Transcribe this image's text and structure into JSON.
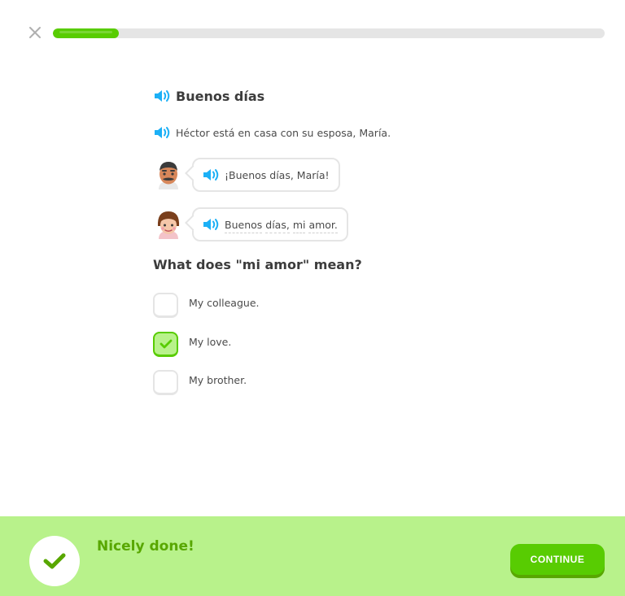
{
  "header": {
    "close_icon": "close-x-icon",
    "progress_fraction": 0.12
  },
  "story": {
    "title": "Buenos días",
    "narration": "Héctor está en casa con su esposa, María.",
    "lines": [
      {
        "speaker_icon": "man-avatar",
        "text": "¡Buenos días, María!"
      },
      {
        "speaker_icon": "woman-avatar",
        "words": [
          "Buenos",
          "días,",
          "mi",
          "amor."
        ]
      }
    ]
  },
  "question": {
    "prompt": "What does \"mi amor\" mean?",
    "options": [
      {
        "label": "My colleague.",
        "selected": false
      },
      {
        "label": "My love.",
        "selected": true
      },
      {
        "label": "My brother.",
        "selected": false
      }
    ]
  },
  "footer": {
    "message": "Nicely done!",
    "button_label": "CONTINUE",
    "icon": "checkmark-icon"
  },
  "colors": {
    "accent_green": "#58cc02",
    "footer_bg": "#b8f28b",
    "message_green": "#58a700",
    "audio_blue": "#1cb0f6",
    "track_gray": "#e5e5e5"
  }
}
